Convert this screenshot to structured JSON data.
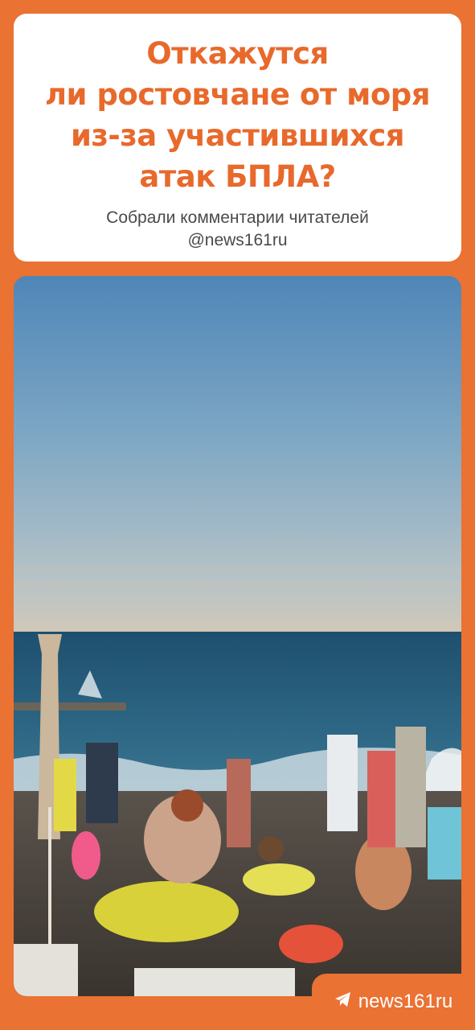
{
  "header": {
    "title_lines": [
      "Откажутся",
      "ли ростовчане от моря",
      "из-за участившихся",
      "атак БПЛА?"
    ],
    "subtitle_lines": [
      "Собрали комментарии читателей",
      "@news161ru"
    ]
  },
  "brand": {
    "name": "news161ru",
    "icon": "telegram-icon"
  },
  "colors": {
    "accent": "#ea7232",
    "title": "#e8692c",
    "card": "#ffffff"
  }
}
